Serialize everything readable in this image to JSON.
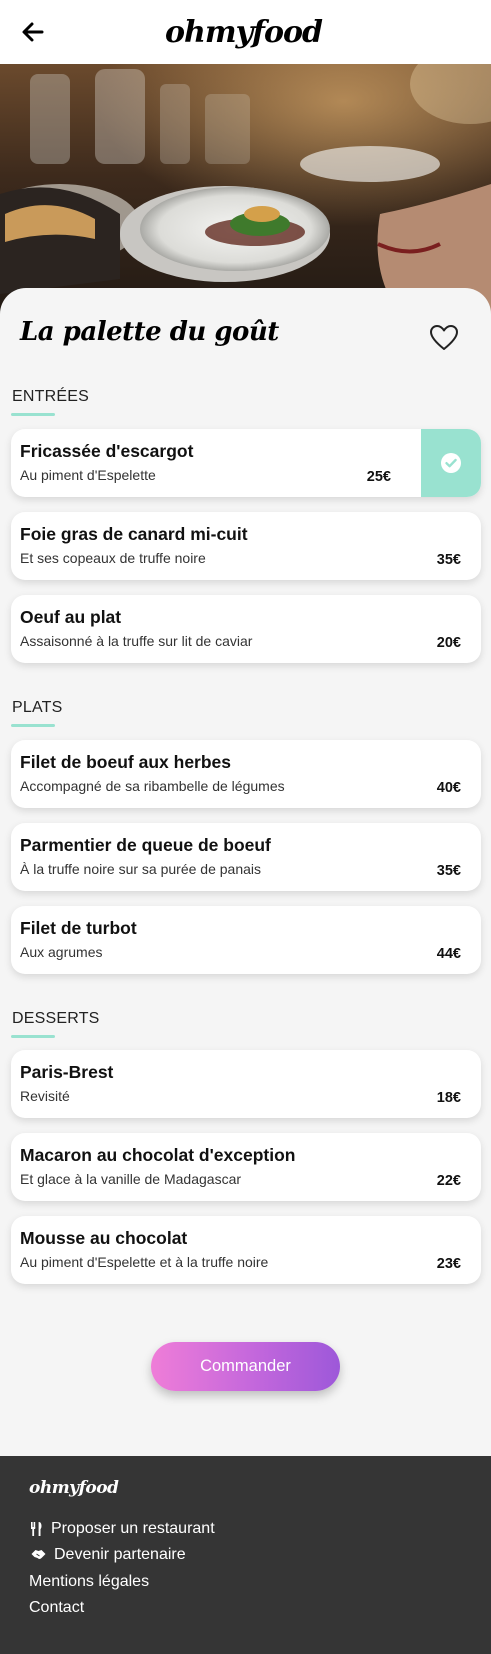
{
  "header": {
    "logo": "ohmyfood",
    "back_icon": "arrow-left-icon"
  },
  "restaurant": {
    "name": "La palette du goût",
    "favorite_icon": "heart-outline-icon"
  },
  "sections": [
    {
      "title": "ENTRÉES",
      "items": [
        {
          "name": "Fricassée d'escargot",
          "desc": "Au piment d'Espelette",
          "price": "25€",
          "selected": true
        },
        {
          "name": "Foie gras de canard mi-cuit",
          "desc": "Et ses copeaux de truffe noire",
          "price": "35€",
          "selected": false
        },
        {
          "name": "Oeuf au plat",
          "desc": "Assaisonné à la truffe sur lit de caviar",
          "price": "20€",
          "selected": false
        }
      ]
    },
    {
      "title": "PLATS",
      "items": [
        {
          "name": "Filet de boeuf aux herbes",
          "desc": "Accompagné de sa ribambelle de légumes",
          "price": "40€",
          "selected": false
        },
        {
          "name": "Parmentier de queue de boeuf",
          "desc": "À la truffe noire sur sa purée de panais",
          "price": "35€",
          "selected": false
        },
        {
          "name": "Filet de turbot",
          "desc": "Aux agrumes",
          "price": "44€",
          "selected": false
        }
      ]
    },
    {
      "title": "DESSERTS",
      "items": [
        {
          "name": "Paris-Brest",
          "desc": "Revisité",
          "price": "18€",
          "selected": false
        },
        {
          "name": "Macaron au chocolat d'exception",
          "desc": "Et glace à la vanille de Madagascar",
          "price": "22€",
          "selected": false
        },
        {
          "name": "Mousse au chocolat",
          "desc": "Au piment d'Espelette et à la truffe noire",
          "price": "23€",
          "selected": false
        }
      ]
    }
  ],
  "order_button": "Commander",
  "footer": {
    "logo": "ohmyfood",
    "links": [
      {
        "label": "Proposer un restaurant",
        "icon": "utensils-icon"
      },
      {
        "label": "Devenir partenaire",
        "icon": "handshake-icon"
      },
      {
        "label": "Mentions légales",
        "icon": ""
      },
      {
        "label": "Contact",
        "icon": ""
      }
    ]
  },
  "colors": {
    "accent": "#99e2d0",
    "button_gradient_start": "#ef7dd8",
    "button_gradient_end": "#9d58d9",
    "footer_bg": "#353535"
  }
}
